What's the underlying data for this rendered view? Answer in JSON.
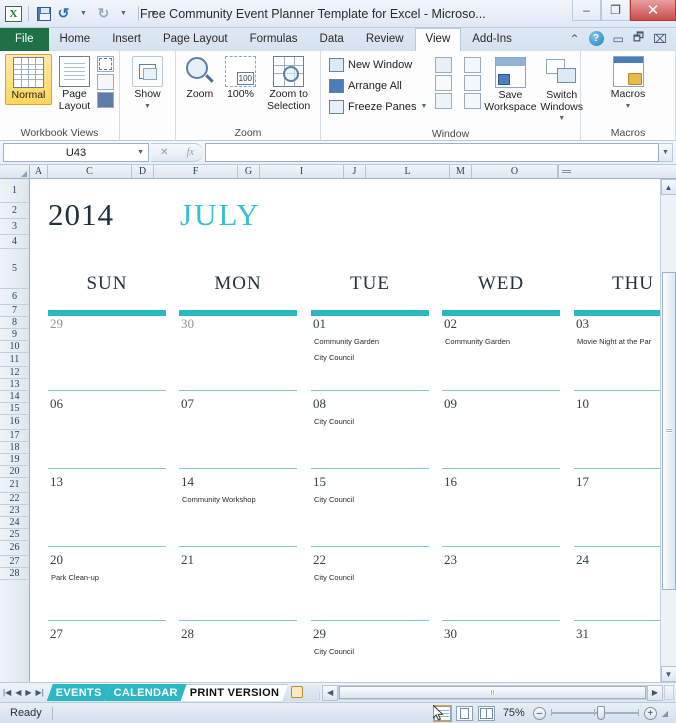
{
  "window": {
    "title": "Free Community Event Planner Template for Excel  - Microso...",
    "minimize": "–",
    "maximize": "❐",
    "close": "✕"
  },
  "qat": {
    "app_icon": "excel-logo",
    "items": [
      "save-icon",
      "undo-icon",
      "redo-icon",
      "customize-qat-icon"
    ]
  },
  "ribbon": {
    "tabs": [
      {
        "label": "File",
        "active": false,
        "type": "file"
      },
      {
        "label": "Home",
        "active": false
      },
      {
        "label": "Insert",
        "active": false
      },
      {
        "label": "Page Layout",
        "active": false
      },
      {
        "label": "Formulas",
        "active": false
      },
      {
        "label": "Data",
        "active": false
      },
      {
        "label": "Review",
        "active": false
      },
      {
        "label": "View",
        "active": true
      },
      {
        "label": "Add-Ins",
        "active": false
      }
    ],
    "right_icons": [
      "minimize-ribbon-icon",
      "help-icon",
      "restore-down-icon",
      "restore-window-icon",
      "close-window-icon"
    ],
    "help_glyph": "?",
    "groups": [
      {
        "label": "Workbook Views",
        "buttons": [
          {
            "label": "Normal",
            "selected": true
          },
          {
            "label": "Page\nLayout",
            "selected": false
          }
        ],
        "small": [
          "page-break-preview-icon",
          "custom-views-icon",
          "full-screen-icon"
        ]
      },
      {
        "label": "Zoom",
        "buttons": [
          {
            "label": "Show",
            "selected": false,
            "has_dropdown": true
          },
          {
            "label": "Zoom",
            "selected": false
          },
          {
            "label": "100%",
            "selected": false
          },
          {
            "label": "Zoom to\nSelection",
            "selected": false
          }
        ]
      },
      {
        "label": "Window",
        "items": [
          "New Window",
          "Arrange All",
          "Freeze Panes"
        ],
        "buttons": [
          {
            "label": "Save\nWorkspace"
          },
          {
            "label": "Switch\nWindows"
          }
        ]
      },
      {
        "label": "Macros",
        "buttons": [
          {
            "label": "Macros",
            "has_dropdown": true
          }
        ]
      }
    ]
  },
  "formula_bar": {
    "name_box": "U43",
    "formula_value": "",
    "fx_label": "fx",
    "cancel": "✕",
    "confirm": "✓"
  },
  "grid": {
    "columns": [
      "A",
      "C",
      "D",
      "F",
      "G",
      "I",
      "J",
      "L",
      "M",
      "O"
    ],
    "rows": [
      "1",
      "2",
      "3",
      "4",
      "5",
      "6",
      "7",
      "8",
      "9",
      "10",
      "11",
      "12",
      "13",
      "14",
      "15",
      "16",
      "17",
      "18",
      "19",
      "20",
      "21",
      "22",
      "23",
      "24",
      "25",
      "26",
      "27",
      "28"
    ]
  },
  "calendar": {
    "year": "2014",
    "month": "JULY",
    "daynames": [
      "SUN",
      "MON",
      "TUE",
      "WED",
      "THU"
    ],
    "weeks": [
      [
        {
          "date": "29",
          "dim": true,
          "events": []
        },
        {
          "date": "30",
          "dim": true,
          "events": []
        },
        {
          "date": "01",
          "dim": false,
          "events": [
            "Community Garden",
            "City Council"
          ]
        },
        {
          "date": "02",
          "dim": false,
          "events": [
            "Community Garden"
          ]
        },
        {
          "date": "03",
          "dim": false,
          "events": [
            "Movie Night at the Par"
          ]
        }
      ],
      [
        {
          "date": "06",
          "dim": false,
          "events": []
        },
        {
          "date": "07",
          "dim": false,
          "events": []
        },
        {
          "date": "08",
          "dim": false,
          "events": [
            "City Council"
          ]
        },
        {
          "date": "09",
          "dim": false,
          "events": []
        },
        {
          "date": "10",
          "dim": false,
          "events": []
        }
      ],
      [
        {
          "date": "13",
          "dim": false,
          "events": []
        },
        {
          "date": "14",
          "dim": false,
          "events": [
            "Community Workshop"
          ]
        },
        {
          "date": "15",
          "dim": false,
          "events": [
            "City Council"
          ]
        },
        {
          "date": "16",
          "dim": false,
          "events": []
        },
        {
          "date": "17",
          "dim": false,
          "events": []
        }
      ],
      [
        {
          "date": "20",
          "dim": false,
          "events": [
            "Park Clean-up"
          ]
        },
        {
          "date": "21",
          "dim": false,
          "events": []
        },
        {
          "date": "22",
          "dim": false,
          "events": [
            "City Council"
          ]
        },
        {
          "date": "23",
          "dim": false,
          "events": []
        },
        {
          "date": "24",
          "dim": false,
          "events": []
        }
      ],
      [
        {
          "date": "27",
          "dim": false,
          "events": []
        },
        {
          "date": "28",
          "dim": false,
          "events": []
        },
        {
          "date": "29",
          "dim": false,
          "events": [
            "City Council"
          ]
        },
        {
          "date": "30",
          "dim": false,
          "events": []
        },
        {
          "date": "31",
          "dim": false,
          "events": []
        }
      ]
    ],
    "accent_color": "#2bb8c4",
    "month_color": "#35c3cf",
    "year_color": "#203040"
  },
  "sheet_tabs": {
    "nav": [
      "first-sheet-icon",
      "prev-sheet-icon",
      "next-sheet-icon",
      "last-sheet-icon"
    ],
    "tabs": [
      {
        "label": "EVENTS",
        "state": "teal"
      },
      {
        "label": "CALENDAR",
        "state": "teal"
      },
      {
        "label": "PRINT VERSION",
        "state": "active"
      }
    ],
    "insert_sheet": "insert-worksheet-icon"
  },
  "status_bar": {
    "status": "Ready",
    "view_buttons": [
      "normal-view-icon",
      "page-layout-view-icon",
      "page-break-preview-icon"
    ],
    "selected_view": 0,
    "zoom_level": "75%",
    "zoom_out": "–",
    "zoom_in": "+"
  }
}
